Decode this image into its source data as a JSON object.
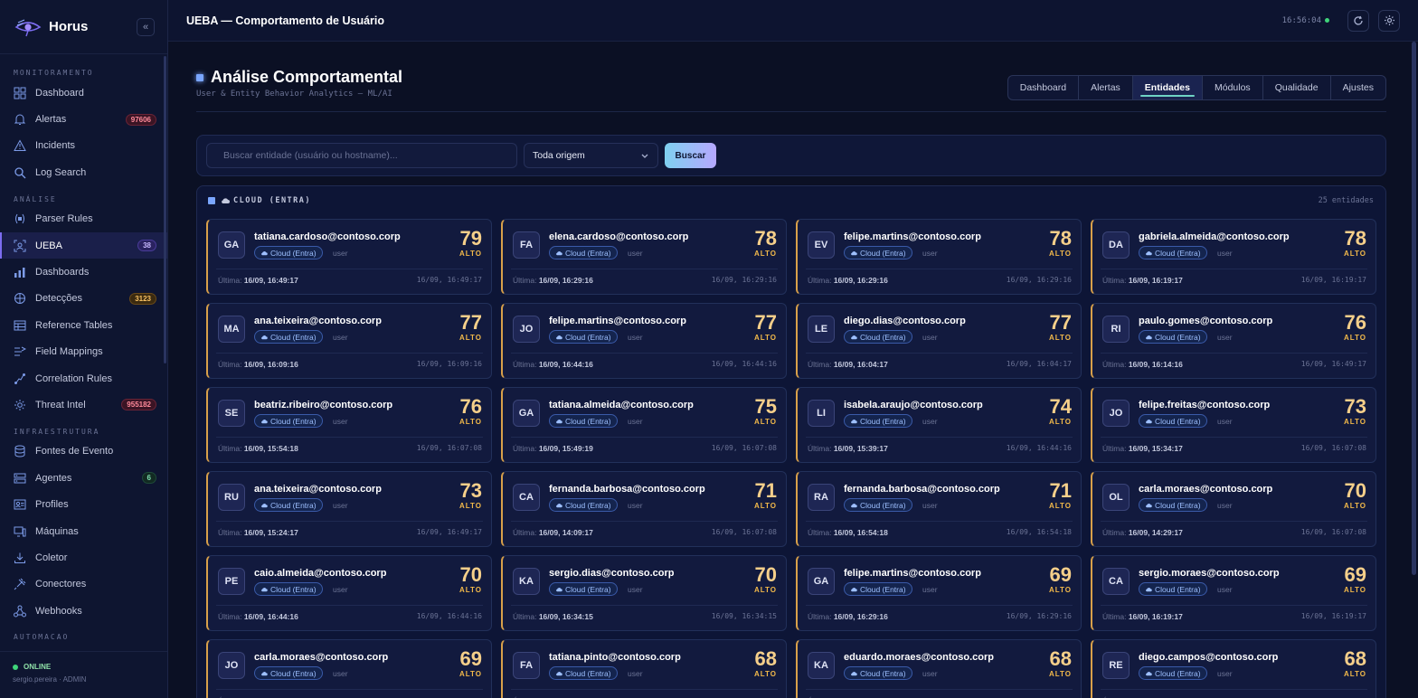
{
  "brand": {
    "name": "Horus"
  },
  "sidebar": {
    "sections": [
      {
        "title": "MONITORAMENTO",
        "items": [
          {
            "label": "Dashboard",
            "icon": "grid-icon"
          },
          {
            "label": "Alertas",
            "icon": "bell-icon",
            "badge": "97606",
            "badge_color": "red"
          },
          {
            "label": "Incidents",
            "icon": "warning-icon"
          },
          {
            "label": "Log Search",
            "icon": "search-icon"
          }
        ]
      },
      {
        "title": "ANÁLISE",
        "items": [
          {
            "label": "Parser Rules",
            "icon": "parser-icon"
          },
          {
            "label": "UEBA",
            "icon": "ueba-icon",
            "badge": "38",
            "badge_color": "purple",
            "active": true
          },
          {
            "label": "Dashboards",
            "icon": "bar-chart-icon"
          },
          {
            "label": "Detecções",
            "icon": "target-icon",
            "badge": "3123",
            "badge_color": "orange"
          },
          {
            "label": "Reference Tables",
            "icon": "table-icon"
          },
          {
            "label": "Field Mappings",
            "icon": "mapping-icon"
          },
          {
            "label": "Correlation Rules",
            "icon": "correlation-icon"
          },
          {
            "label": "Threat Intel",
            "icon": "gear-icon",
            "badge": "955182",
            "badge_color": "red"
          }
        ]
      },
      {
        "title": "INFRAESTRUTURA",
        "items": [
          {
            "label": "Fontes de Evento",
            "icon": "database-icon"
          },
          {
            "label": "Agentes",
            "icon": "server-icon",
            "badge": "6",
            "badge_color": "green"
          },
          {
            "label": "Profiles",
            "icon": "profile-icon"
          },
          {
            "label": "Máquinas",
            "icon": "monitor-icon"
          },
          {
            "label": "Coletor",
            "icon": "download-icon"
          },
          {
            "label": "Conectores",
            "icon": "plug-icon"
          },
          {
            "label": "Webhooks",
            "icon": "webhook-icon"
          }
        ]
      },
      {
        "title": "AUTOMACAO",
        "items": []
      }
    ],
    "footer": {
      "status": "ONLINE",
      "user": "sergio.pereira · ADMIN"
    }
  },
  "topbar": {
    "title": "UEBA — Comportamento de Usuário",
    "clock": "16:56:04"
  },
  "page": {
    "title": "Análise Comportamental",
    "subtitle": "User & Entity Behavior Analytics — ML/AI",
    "tabs": [
      {
        "label": "Dashboard"
      },
      {
        "label": "Alertas"
      },
      {
        "label": "Entidades",
        "active": true
      },
      {
        "label": "Módulos"
      },
      {
        "label": "Qualidade"
      },
      {
        "label": "Ajustes"
      }
    ]
  },
  "search": {
    "placeholder": "Buscar entidade (usuário ou hostname)...",
    "origin": "Toda origem",
    "button": "Buscar"
  },
  "group": {
    "title": "CLOUD (ENTRA)",
    "count": "25 entidades",
    "last_label": "Última:",
    "entities": [
      {
        "initials": "GA",
        "name": "tatiana.cardoso@contoso.corp",
        "source": "Cloud (Entra)",
        "type": "user",
        "score": "79",
        "risk": "ALTO",
        "last": "16/09, 16:49:17",
        "ts": "16/09, 16:49:17"
      },
      {
        "initials": "FA",
        "name": "elena.cardoso@contoso.corp",
        "source": "Cloud (Entra)",
        "type": "user",
        "score": "78",
        "risk": "ALTO",
        "last": "16/09, 16:29:16",
        "ts": "16/09, 16:29:16"
      },
      {
        "initials": "EV",
        "name": "felipe.martins@contoso.corp",
        "source": "Cloud (Entra)",
        "type": "user",
        "score": "78",
        "risk": "ALTO",
        "last": "16/09, 16:29:16",
        "ts": "16/09, 16:29:16"
      },
      {
        "initials": "DA",
        "name": "gabriela.almeida@contoso.corp",
        "source": "Cloud (Entra)",
        "type": "user",
        "score": "78",
        "risk": "ALTO",
        "last": "16/09, 16:19:17",
        "ts": "16/09, 16:19:17"
      },
      {
        "initials": "MA",
        "name": "ana.teixeira@contoso.corp",
        "source": "Cloud (Entra)",
        "type": "user",
        "score": "77",
        "risk": "ALTO",
        "last": "16/09, 16:09:16",
        "ts": "16/09, 16:09:16"
      },
      {
        "initials": "JO",
        "name": "felipe.martins@contoso.corp",
        "source": "Cloud (Entra)",
        "type": "user",
        "score": "77",
        "risk": "ALTO",
        "last": "16/09, 16:44:16",
        "ts": "16/09, 16:44:16"
      },
      {
        "initials": "LE",
        "name": "diego.dias@contoso.corp",
        "source": "Cloud (Entra)",
        "type": "user",
        "score": "77",
        "risk": "ALTO",
        "last": "16/09, 16:04:17",
        "ts": "16/09, 16:04:17"
      },
      {
        "initials": "RI",
        "name": "paulo.gomes@contoso.corp",
        "source": "Cloud (Entra)",
        "type": "user",
        "score": "76",
        "risk": "ALTO",
        "last": "16/09, 16:14:16",
        "ts": "16/09, 16:49:17"
      },
      {
        "initials": "SE",
        "name": "beatriz.ribeiro@contoso.corp",
        "source": "Cloud (Entra)",
        "type": "user",
        "score": "76",
        "risk": "ALTO",
        "last": "16/09, 15:54:18",
        "ts": "16/09, 16:07:08"
      },
      {
        "initials": "GA",
        "name": "tatiana.almeida@contoso.corp",
        "source": "Cloud (Entra)",
        "type": "user",
        "score": "75",
        "risk": "ALTO",
        "last": "16/09, 15:49:19",
        "ts": "16/09, 16:07:08"
      },
      {
        "initials": "LI",
        "name": "isabela.araujo@contoso.corp",
        "source": "Cloud (Entra)",
        "type": "user",
        "score": "74",
        "risk": "ALTO",
        "last": "16/09, 15:39:17",
        "ts": "16/09, 16:44:16"
      },
      {
        "initials": "JO",
        "name": "felipe.freitas@contoso.corp",
        "source": "Cloud (Entra)",
        "type": "user",
        "score": "73",
        "risk": "ALTO",
        "last": "16/09, 15:34:17",
        "ts": "16/09, 16:07:08"
      },
      {
        "initials": "RU",
        "name": "ana.teixeira@contoso.corp",
        "source": "Cloud (Entra)",
        "type": "user",
        "score": "73",
        "risk": "ALTO",
        "last": "16/09, 15:24:17",
        "ts": "16/09, 16:49:17"
      },
      {
        "initials": "CA",
        "name": "fernanda.barbosa@contoso.corp",
        "source": "Cloud (Entra)",
        "type": "user",
        "score": "71",
        "risk": "ALTO",
        "last": "16/09, 14:09:17",
        "ts": "16/09, 16:07:08"
      },
      {
        "initials": "RA",
        "name": "fernanda.barbosa@contoso.corp",
        "source": "Cloud (Entra)",
        "type": "user",
        "score": "71",
        "risk": "ALTO",
        "last": "16/09, 16:54:18",
        "ts": "16/09, 16:54:18"
      },
      {
        "initials": "OL",
        "name": "carla.moraes@contoso.corp",
        "source": "Cloud (Entra)",
        "type": "user",
        "score": "70",
        "risk": "ALTO",
        "last": "16/09, 14:29:17",
        "ts": "16/09, 16:07:08"
      },
      {
        "initials": "PE",
        "name": "caio.almeida@contoso.corp",
        "source": "Cloud (Entra)",
        "type": "user",
        "score": "70",
        "risk": "ALTO",
        "last": "16/09, 16:44:16",
        "ts": "16/09, 16:44:16"
      },
      {
        "initials": "KA",
        "name": "sergio.dias@contoso.corp",
        "source": "Cloud (Entra)",
        "type": "user",
        "score": "70",
        "risk": "ALTO",
        "last": "16/09, 16:34:15",
        "ts": "16/09, 16:34:15"
      },
      {
        "initials": "GA",
        "name": "felipe.martins@contoso.corp",
        "source": "Cloud (Entra)",
        "type": "user",
        "score": "69",
        "risk": "ALTO",
        "last": "16/09, 16:29:16",
        "ts": "16/09, 16:29:16"
      },
      {
        "initials": "CA",
        "name": "sergio.moraes@contoso.corp",
        "source": "Cloud (Entra)",
        "type": "user",
        "score": "69",
        "risk": "ALTO",
        "last": "16/09, 16:19:17",
        "ts": "16/09, 16:19:17"
      },
      {
        "initials": "JO",
        "name": "carla.moraes@contoso.corp",
        "source": "Cloud (Entra)",
        "type": "user",
        "score": "69",
        "risk": "ALTO",
        "last": "",
        "ts": ""
      },
      {
        "initials": "FA",
        "name": "tatiana.pinto@contoso.corp",
        "source": "Cloud (Entra)",
        "type": "user",
        "score": "68",
        "risk": "ALTO",
        "last": "",
        "ts": ""
      },
      {
        "initials": "KA",
        "name": "eduardo.moraes@contoso.corp",
        "source": "Cloud (Entra)",
        "type": "user",
        "score": "68",
        "risk": "ALTO",
        "last": "",
        "ts": ""
      },
      {
        "initials": "RE",
        "name": "diego.campos@contoso.corp",
        "source": "Cloud (Entra)",
        "type": "user",
        "score": "68",
        "risk": "ALTO",
        "last": "",
        "ts": ""
      }
    ]
  },
  "colors": {
    "accent": "#7c6cf0",
    "risk_high": "#f2b94a",
    "score": "#f5cf8a",
    "bg": "#0b1024"
  }
}
